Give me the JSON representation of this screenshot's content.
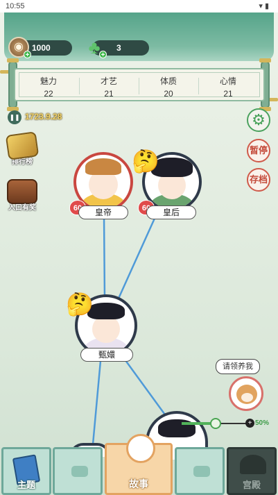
{
  "status_bar": {
    "time": "10:55",
    "icons": "wifi-icon battery-icon"
  },
  "currency": {
    "coins": "1000",
    "gems": "3",
    "coin_icon": "coin-icon",
    "gem_icon": "gem-icon"
  },
  "stats": [
    {
      "label": "魅力",
      "value": "22"
    },
    {
      "label": "才艺",
      "value": "21"
    },
    {
      "label": "体质",
      "value": "20"
    },
    {
      "label": "心情",
      "value": "21"
    }
  ],
  "game": {
    "date": "1723.9.28"
  },
  "right_buttons": {
    "pause": "暂停",
    "save": "存档"
  },
  "side_items": [
    {
      "label": "排行榜",
      "icon": "trophy-icon"
    },
    {
      "label": "入口有奖",
      "icon": "treasure-chest-icon"
    }
  ],
  "characters": {
    "emperor": {
      "name": "皇帝",
      "favor": "60"
    },
    "empress": {
      "name": "皇后",
      "favor": "60"
    },
    "protagonist": {
      "name": "甄嬛"
    }
  },
  "pet": {
    "prompt": "请领养我"
  },
  "progress": {
    "percent_label": "50%",
    "value": 0.5
  },
  "nav": {
    "tabs": [
      {
        "label": "主题"
      },
      {
        "label": ""
      },
      {
        "label": "故事"
      },
      {
        "label": ""
      },
      {
        "label": "宫殿"
      }
    ]
  },
  "colors": {
    "accent_green": "#56a48a",
    "heart_red": "#e04b4b",
    "button_red": "#cf5a4a"
  }
}
